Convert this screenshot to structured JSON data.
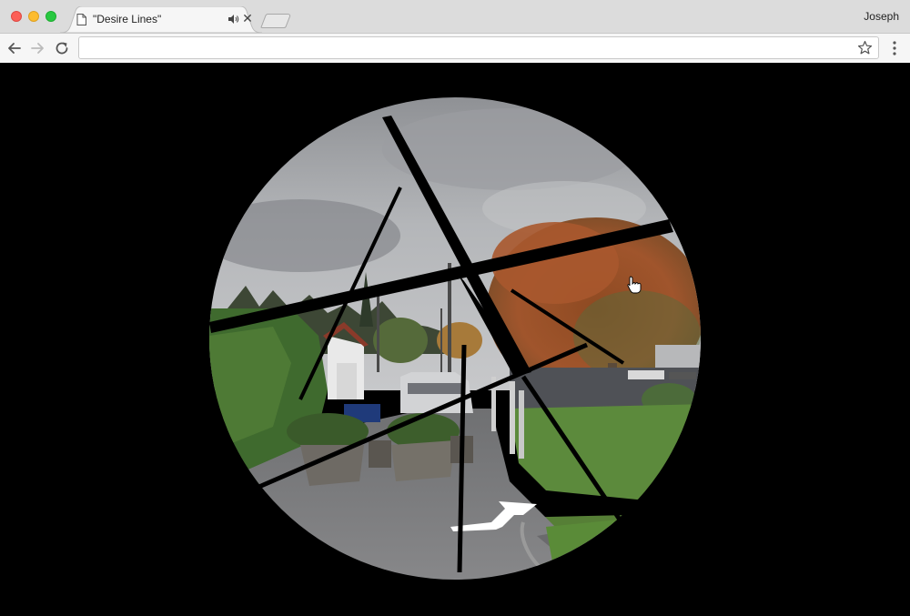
{
  "window": {
    "tab_title": "\"Desire Lines\"",
    "profile_name": "Joseph"
  },
  "toolbar": {
    "url": "",
    "icons": {
      "back": "back-arrow-icon",
      "forward": "forward-arrow-icon",
      "reload": "reload-icon",
      "bookmark": "star-icon",
      "menu": "kebab-menu-icon"
    }
  },
  "colors": {
    "page_background": "#000000",
    "sky": "#a9abae",
    "foliage_red": "#a4582f",
    "lawn": "#5c8a3c",
    "road": "#7c7c7e"
  },
  "scene": {
    "description_icon": "street-view-arrow-icon",
    "cursor": "hand-pointer-icon"
  }
}
